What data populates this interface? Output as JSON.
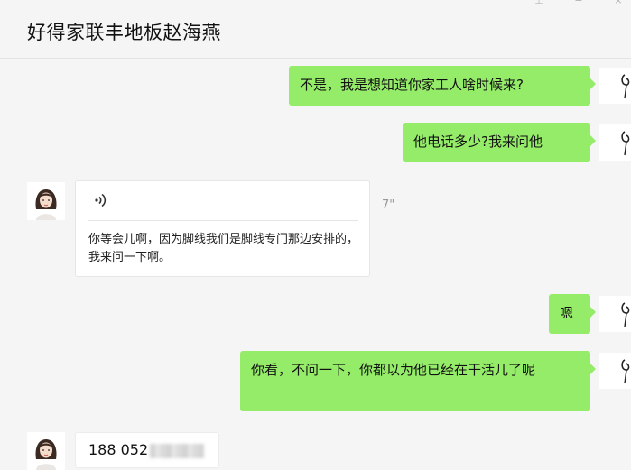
{
  "header": {
    "title": "好得家联丰地板赵海燕"
  },
  "messages": {
    "m1": {
      "text": "不是，我是想知道你家工人啥时候来?"
    },
    "m2": {
      "text": "他电话多少?我来问他"
    },
    "voice": {
      "duration": "7\"",
      "transcript": "你等会儿啊，因为脚线我们是脚线专门那边安排的，我来问一下啊。"
    },
    "m4": {
      "text": "嗯"
    },
    "m5": {
      "text": "你看，不问一下，你都以为他已经在干活儿了呢"
    },
    "phone": {
      "visible": "188 052"
    }
  },
  "colors": {
    "sent_bubble": "#95ec69",
    "received_bubble": "#ffffff",
    "background": "#f5f5f5"
  },
  "icons": {
    "voice": "voice-wave-icon",
    "window_pin": "pin-icon",
    "window_min": "minimize-icon",
    "window_close": "close-icon"
  }
}
